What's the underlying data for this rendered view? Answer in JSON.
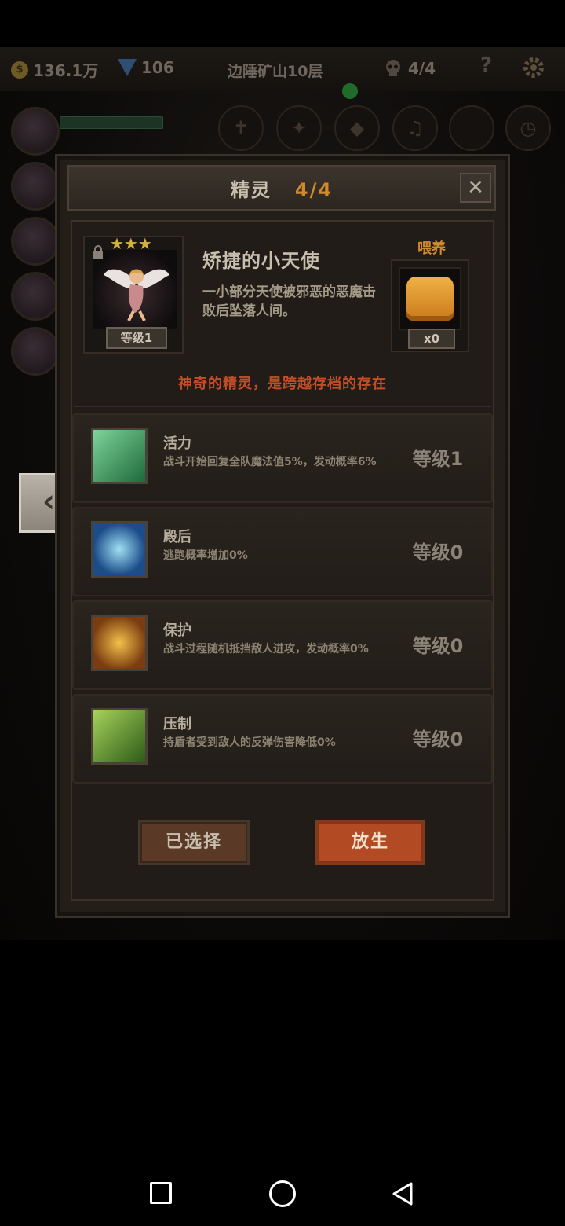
{
  "hud": {
    "gold": "136.1万",
    "gems": "106",
    "location": "边陲矿山10层",
    "skulls": "4/4",
    "help": "?",
    "coin_symbol": "$"
  },
  "dialog": {
    "title": "精灵",
    "count": "4/4",
    "close_symbol": "✕"
  },
  "sprite": {
    "stars": "★★★",
    "name": "矫捷的小天使",
    "description": "一小部分天使被邪恶的恶魔击败后坠落人间。",
    "level": "等级1",
    "feed_label": "喂养",
    "feed_count": "x0",
    "tagline": "神奇的精灵，是跨越存档的存在"
  },
  "skills": [
    {
      "name": "活力",
      "description": "战斗开始回复全队魔法值5%，发动概率6%",
      "level": "等级1",
      "icon": "praying-hands-icon"
    },
    {
      "name": "殿后",
      "description": "逃跑概率增加0%",
      "level": "等级0",
      "icon": "wings-icon"
    },
    {
      "name": "保护",
      "description": "战斗过程随机抵挡敌人进攻，发动概率0%",
      "level": "等级0",
      "icon": "fairy-shield-icon"
    },
    {
      "name": "压制",
      "description": "持盾者受到敌人的反弹伤害降低0%",
      "level": "等级0",
      "icon": "claw-icon"
    }
  ],
  "buttons": {
    "selected": "已选择",
    "release": "放生"
  },
  "side": {
    "back_symbol": "‹"
  },
  "colors": {
    "accent_orange": "#d08a2b",
    "tagline_red": "#c24e28",
    "release_button": "#b24a24"
  }
}
